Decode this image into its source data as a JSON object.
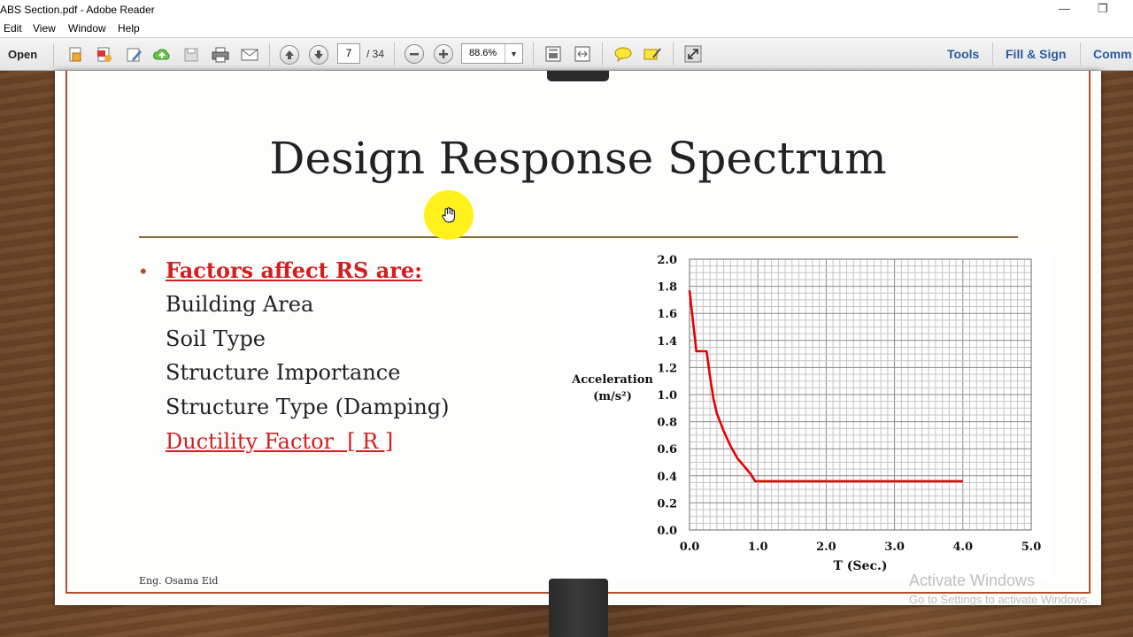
{
  "window": {
    "title": "ABS Section.pdf - Adobe Reader"
  },
  "menu": {
    "items": [
      "Edit",
      "View",
      "Window",
      "Help"
    ]
  },
  "toolbar": {
    "open_label": "Open",
    "page_current": "7",
    "page_total": "/ 34",
    "zoom": "88.6%",
    "tools_label": "Tools",
    "fill_sign_label": "Fill & Sign",
    "comment_label": "Comm"
  },
  "slide": {
    "title": "Design Response Spectrum",
    "heading": "Factors affect RS are:",
    "items": [
      "Building Area",
      "Soil Type",
      "Structure Importance",
      "Structure Type (Damping)",
      "Ductility Factor  [ R ]"
    ],
    "author": "Eng. Osama Eid"
  },
  "watermark": {
    "line1": "Activate Windows",
    "line2": "Go to Settings to activate Windows."
  },
  "colors": {
    "accent_red": "#d21f1f",
    "frame_brown": "#b24f2a",
    "cursor_yellow": "#fff21c",
    "link_blue": "#2b5c9e"
  },
  "chart_data": {
    "type": "line",
    "title": "",
    "xlabel": "T (Sec.)",
    "ylabel": "Acceleration (m/s²)",
    "ylabel_lines": [
      "Acceleration",
      "(m/s²)"
    ],
    "xlim": [
      0,
      5
    ],
    "ylim": [
      0,
      2
    ],
    "xticks": [
      "0.0",
      "1.0",
      "2.0",
      "3.0",
      "4.0",
      "5.0"
    ],
    "yticks": [
      "0.0",
      "0.2",
      "0.4",
      "0.6",
      "0.8",
      "1.0",
      "1.2",
      "1.4",
      "1.6",
      "1.8",
      "2.0"
    ],
    "grid": true,
    "series": [
      {
        "color": "#e60000",
        "x": [
          0.0,
          0.1,
          0.1,
          0.25,
          0.3,
          0.35,
          0.4,
          0.5,
          0.6,
          0.7,
          0.8,
          0.9,
          0.96,
          4.0
        ],
        "y": [
          1.77,
          1.32,
          1.32,
          1.32,
          1.13,
          0.97,
          0.86,
          0.73,
          0.62,
          0.53,
          0.47,
          0.41,
          0.36,
          0.36
        ]
      }
    ]
  }
}
